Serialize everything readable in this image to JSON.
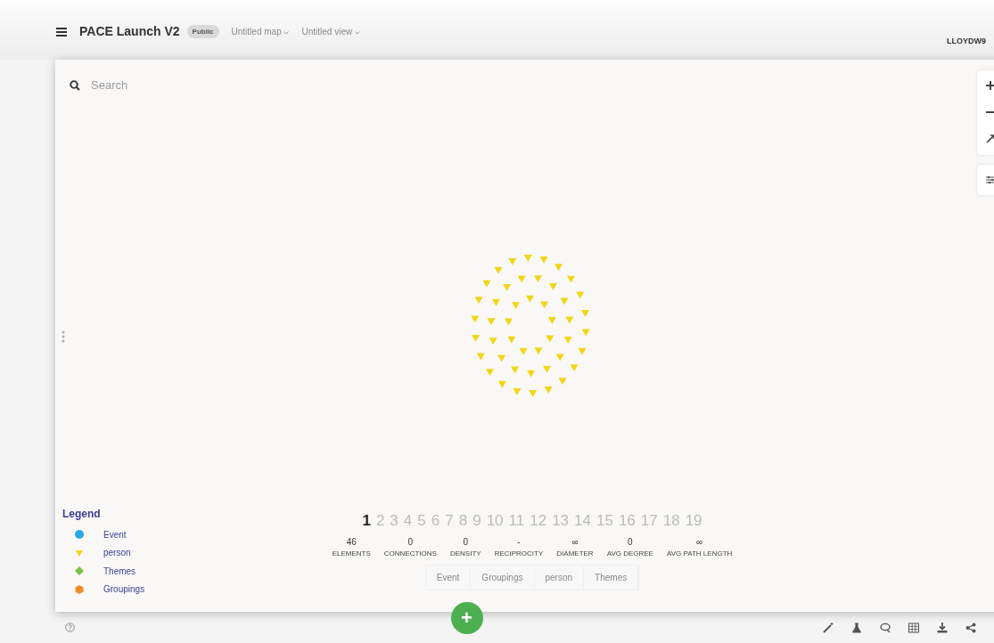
{
  "header": {
    "title": "PACE Launch V2",
    "badge": "Public",
    "map_menu": "Untitled map",
    "view_menu": "Untitled view",
    "user": "LLOYDW9"
  },
  "search": {
    "placeholder": "Search"
  },
  "legend": {
    "title": "Legend",
    "items": [
      {
        "label": "Event",
        "color": "#29a8e6",
        "kind": "circle"
      },
      {
        "label": "person",
        "color": "#f2d516",
        "kind": "triangle"
      },
      {
        "label": "Themes",
        "color": "#7cc142",
        "kind": "diamond"
      },
      {
        "label": "Groupings",
        "color": "#f28c28",
        "kind": "hexagon"
      }
    ]
  },
  "pages": [
    {
      "label": "1",
      "selected": true
    },
    {
      "label": "2",
      "selected": false
    },
    {
      "label": "3",
      "selected": false
    },
    {
      "label": "4",
      "selected": false
    },
    {
      "label": "5",
      "selected": false
    },
    {
      "label": "6",
      "selected": false
    },
    {
      "label": "7",
      "selected": false
    },
    {
      "label": "8",
      "selected": false
    },
    {
      "label": "9",
      "selected": false
    },
    {
      "label": "10",
      "selected": false
    },
    {
      "label": "11",
      "selected": false
    },
    {
      "label": "12",
      "selected": false
    },
    {
      "label": "13",
      "selected": false
    },
    {
      "label": "14",
      "selected": false
    },
    {
      "label": "15",
      "selected": false
    },
    {
      "label": "16",
      "selected": false
    },
    {
      "label": "17",
      "selected": false
    },
    {
      "label": "18",
      "selected": false
    },
    {
      "label": "19",
      "selected": false
    }
  ],
  "stats": [
    {
      "value": "46",
      "label": "ELEMENTS"
    },
    {
      "value": "0",
      "label": "CONNECTIONS"
    },
    {
      "value": "0",
      "label": "DENSITY"
    },
    {
      "value": "-",
      "label": "RECIPROCITY"
    },
    {
      "value": "∞",
      "label": "DIAMETER"
    },
    {
      "value": "0",
      "label": "AVG DEGREE"
    },
    {
      "value": "∞",
      "label": "AVG PATH LENGTH"
    }
  ],
  "filters": [
    "Event",
    "Groupings",
    "person",
    "Themes"
  ],
  "add_button": "+"
}
